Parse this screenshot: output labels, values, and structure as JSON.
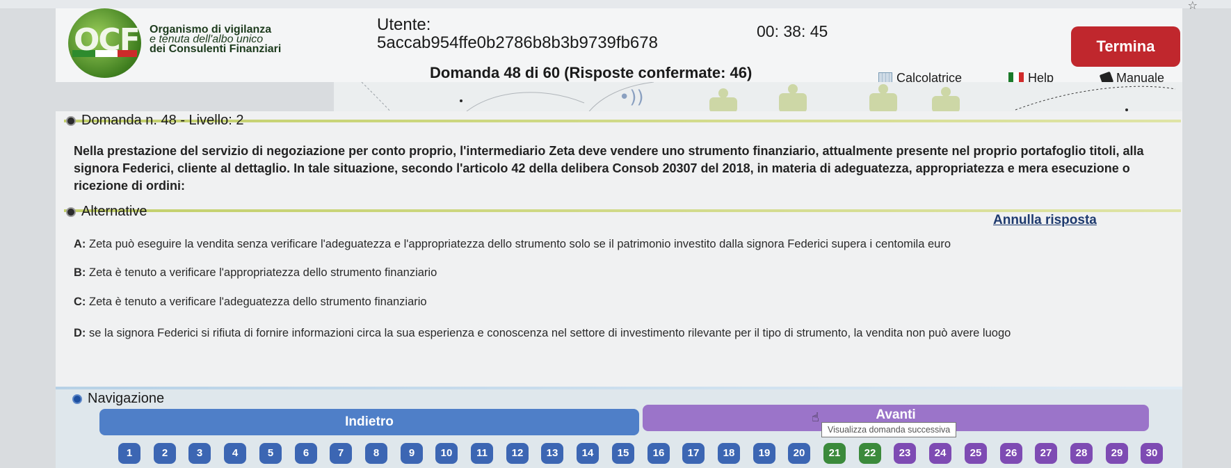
{
  "header": {
    "org_line1": "Organismo di vigilanza",
    "org_line2": "e tenuta dell'albo unico",
    "org_line3": "dei Consulenti Finanziari",
    "logo_text": "OCF",
    "user_label": "Utente:",
    "user_id": "5accab954ffe0b2786b8b3b9739fb678",
    "timer": "00: 38: 45",
    "question_count": "Domanda 48 di 60 (Risposte confermate: 46)",
    "termina_label": "Termina",
    "calc_label": "Calcolatrice",
    "help_label": "Help",
    "manual_label": "Manuale"
  },
  "question": {
    "heading": "Domanda n. 48 - Livello: 2",
    "text": "Nella prestazione del servizio di negoziazione per conto proprio, l'intermediario Zeta deve vendere uno strumento finanziario, attualmente presente nel proprio portafoglio titoli, alla signora Federici, cliente al dettaglio. In tale situazione, secondo l'articolo 42 della delibera Consob 20307 del 2018, in materia di adeguatezza, appropriatezza e mera esecuzione o ricezione di ordini:"
  },
  "alternatives": {
    "heading": "Alternative",
    "annulla": "Annulla risposta",
    "items": [
      {
        "key": "A:",
        "text": "Zeta può eseguire la vendita senza verificare l'adeguatezza e l'appropriatezza dello strumento solo se il patrimonio investito dalla signora Federici supera i centomila euro"
      },
      {
        "key": "B:",
        "text": "Zeta è tenuto a verificare l'appropriatezza dello strumento finanziario"
      },
      {
        "key": "C:",
        "text": "Zeta è tenuto a verificare l'adeguatezza dello strumento finanziario"
      },
      {
        "key": "D:",
        "text": "se la signora Federici si rifiuta di fornire informazioni circa la sua esperienza e conoscenza nel settore di investimento rilevante per il tipo di strumento, la vendita non può avere luogo"
      }
    ]
  },
  "navigation": {
    "heading": "Navigazione",
    "back_label": "Indietro",
    "next_label": "Avanti",
    "next_tooltip": "Visualizza domanda successiva",
    "numbers": [
      "1",
      "2",
      "3",
      "4",
      "5",
      "6",
      "7",
      "8",
      "9",
      "10",
      "11",
      "12",
      "13",
      "14",
      "15",
      "16",
      "17",
      "18",
      "19",
      "20",
      "21",
      "22",
      "23",
      "24",
      "25",
      "26",
      "27",
      "28",
      "29",
      "30"
    ]
  },
  "colors": {
    "termina": "#c0272d",
    "back_button": "#4f7fc8",
    "next_button": "#9b74c9",
    "question_number": "#3c66b3"
  }
}
